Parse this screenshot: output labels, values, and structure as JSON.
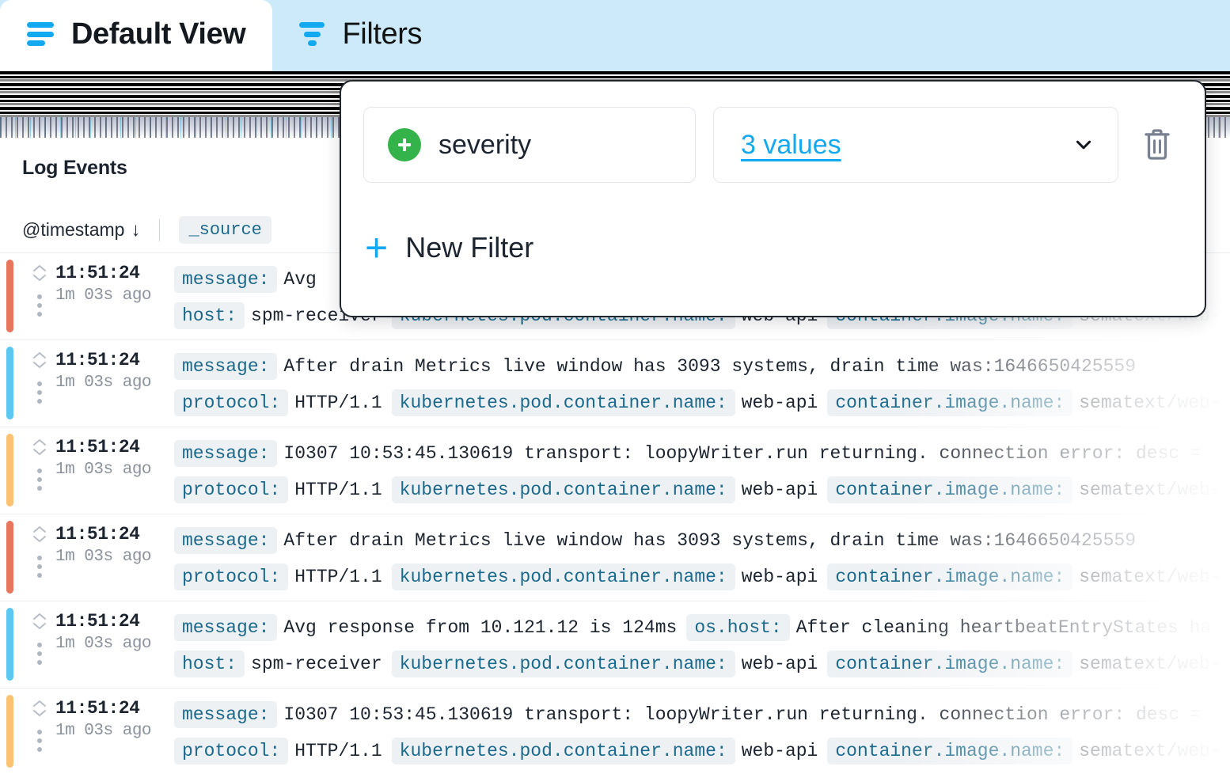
{
  "tabs": [
    {
      "label": "Default View",
      "icon": "list-icon",
      "state": "inactive-white"
    },
    {
      "label": "Filters",
      "icon": "funnel-icon",
      "state": "active"
    }
  ],
  "log_panel": {
    "title": "Log Events",
    "columns": {
      "timestamp": "@timestamp",
      "sort_arrow": "↓",
      "source": "_source"
    },
    "rows": [
      {
        "severity_color": "#e8765d",
        "time": "11:51:24",
        "relative": "1m 03s ago",
        "line1": [
          {
            "type": "field",
            "text": "message:"
          },
          {
            "type": "value",
            "text": "Avg"
          }
        ],
        "line2": [
          {
            "type": "field",
            "text": "host:"
          },
          {
            "type": "value",
            "text": "spm-receiver"
          },
          {
            "type": "field",
            "text": "kubernetes.pod.container.name:"
          },
          {
            "type": "value",
            "text": "web-api"
          },
          {
            "type": "field",
            "text": "container.image.name:"
          },
          {
            "type": "value",
            "text": "sematext/web-"
          }
        ]
      },
      {
        "severity_color": "#5cc8f2",
        "time": "11:51:24",
        "relative": "1m 03s ago",
        "line1": [
          {
            "type": "field",
            "text": "message:"
          },
          {
            "type": "value",
            "text": "After drain Metrics live window has 3093 systems, drain time was:1646650425559"
          }
        ],
        "line2": [
          {
            "type": "field",
            "text": "protocol:"
          },
          {
            "type": "value",
            "text": "HTTP/1.1"
          },
          {
            "type": "field",
            "text": "kubernetes.pod.container.name:"
          },
          {
            "type": "value",
            "text": "web-api"
          },
          {
            "type": "field",
            "text": "container.image.name:"
          },
          {
            "type": "value",
            "text": "sematext/web-"
          }
        ]
      },
      {
        "severity_color": "#fac272",
        "time": "11:51:24",
        "relative": "1m 03s ago",
        "line1": [
          {
            "type": "field",
            "text": "message:"
          },
          {
            "type": "value",
            "text": "I0307 10:53:45.130619 transport: loopyWriter.run returning. connection error: desc ="
          }
        ],
        "line2": [
          {
            "type": "field",
            "text": "protocol:"
          },
          {
            "type": "value",
            "text": "HTTP/1.1"
          },
          {
            "type": "field",
            "text": "kubernetes.pod.container.name:"
          },
          {
            "type": "value",
            "text": "web-api"
          },
          {
            "type": "field",
            "text": "container.image.name:"
          },
          {
            "type": "value",
            "text": "sematext/web-"
          }
        ]
      },
      {
        "severity_color": "#e8765d",
        "time": "11:51:24",
        "relative": "1m 03s ago",
        "line1": [
          {
            "type": "field",
            "text": "message:"
          },
          {
            "type": "value",
            "text": "After drain Metrics live window has 3093 systems, drain time was:1646650425559"
          }
        ],
        "line2": [
          {
            "type": "field",
            "text": "protocol:"
          },
          {
            "type": "value",
            "text": "HTTP/1.1"
          },
          {
            "type": "field",
            "text": "kubernetes.pod.container.name:"
          },
          {
            "type": "value",
            "text": "web-api"
          },
          {
            "type": "field",
            "text": "container.image.name:"
          },
          {
            "type": "value",
            "text": "sematext/web-"
          }
        ]
      },
      {
        "severity_color": "#5cc8f2",
        "time": "11:51:24",
        "relative": "1m 03s ago",
        "line1": [
          {
            "type": "field",
            "text": "message:"
          },
          {
            "type": "value",
            "text": "Avg response from 10.121.12 is 124ms"
          },
          {
            "type": "field",
            "text": "os.host:"
          },
          {
            "type": "value",
            "text": "After cleaning heartbeatEntryStates ha"
          }
        ],
        "line2": [
          {
            "type": "field",
            "text": "host:"
          },
          {
            "type": "value",
            "text": "spm-receiver"
          },
          {
            "type": "field",
            "text": "kubernetes.pod.container.name:"
          },
          {
            "type": "value",
            "text": "web-api"
          },
          {
            "type": "field",
            "text": "container.image.name:"
          },
          {
            "type": "value",
            "text": "sematext/web-"
          }
        ]
      },
      {
        "severity_color": "#fac272",
        "time": "11:51:24",
        "relative": "1m 03s ago",
        "line1": [
          {
            "type": "field",
            "text": "message:"
          },
          {
            "type": "value",
            "text": "I0307 10:53:45.130619 transport: loopyWriter.run returning. connection error: desc ="
          }
        ],
        "line2": [
          {
            "type": "field",
            "text": "protocol:"
          },
          {
            "type": "value",
            "text": "HTTP/1.1"
          },
          {
            "type": "field",
            "text": "kubernetes.pod.container.name:"
          },
          {
            "type": "value",
            "text": "web-api"
          },
          {
            "type": "field",
            "text": "container.image.name:"
          },
          {
            "type": "value",
            "text": "sematext/web-"
          }
        ]
      }
    ]
  },
  "filters_popover": {
    "filter": {
      "field_name": "severity",
      "add_icon": "plus-circle-icon",
      "values_label": "3 values",
      "dropdown_icon": "chevron-down-icon",
      "delete_icon": "trash-icon"
    },
    "new_filter_label": "New Filter",
    "new_filter_icon": "plus-icon"
  },
  "colors": {
    "accent_blue": "#13A9F0",
    "tab_active_bg": "#cdeafb",
    "green_badge": "#34b34a",
    "severity_error": "#e8765d",
    "severity_info": "#5cc8f2",
    "severity_warn": "#fac272",
    "field_chip_text": "#1b6a8c",
    "field_chip_bg": "#eef1f4"
  }
}
